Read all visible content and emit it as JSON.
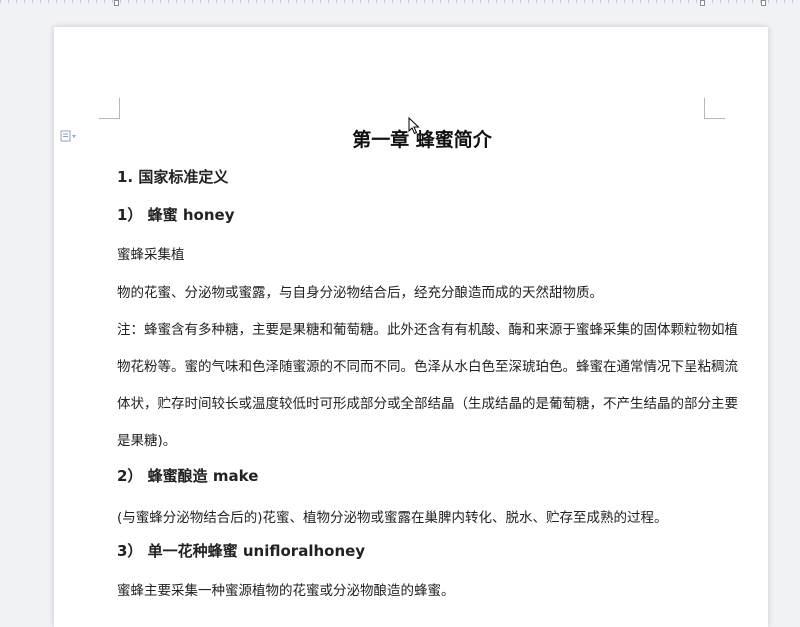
{
  "document": {
    "title": "第一章 蜂蜜简介",
    "section_1": "1.   国家标准定义",
    "sub_1": "1） 蜂蜜 honey",
    "para_1a": "蜜蜂采集植",
    "para_1b": "物的花蜜、分泌物或蜜露，与自身分泌物结合后，经充分酿造而成的天然甜物质。",
    "note_line1": "注：蜂蜜含有多种糖，主要是果糖和葡萄糖。此外还含有有机酸、酶和来源于蜜蜂采集的固体颗粒物如植",
    "note_line2": "物花粉等。蜜的气味和色泽随蜜源的不同而不同。色泽从水白色至深琥珀色。蜂蜜在通常情况下呈粘稠流",
    "note_line3": "体状，贮存时间较长或温度较低时可形成部分或全部结晶（生成结晶的是葡萄糖，不产生结晶的部分主要",
    "note_line4": "是果糖)。",
    "sub_2": "2） 蜂蜜酿造 make",
    "para_2": "(与蜜蜂分泌物结合后的)花蜜、植物分泌物或蜜露在巢脾内转化、脱水、贮存至成熟的过程。",
    "sub_3": "3） 单一花种蜂蜜 unifloralhoney",
    "para_3": "蜜蜂主要采集一种蜜源植物的花蜜或分泌物酿造的蜂蜜。"
  },
  "icons": {
    "paragraph_marker": "paragraph-icon",
    "cursor": "mouse-pointer-icon"
  },
  "colors": {
    "page_bg": "#ffffff",
    "canvas_bg": "#f1f2f6",
    "text": "#222222"
  }
}
